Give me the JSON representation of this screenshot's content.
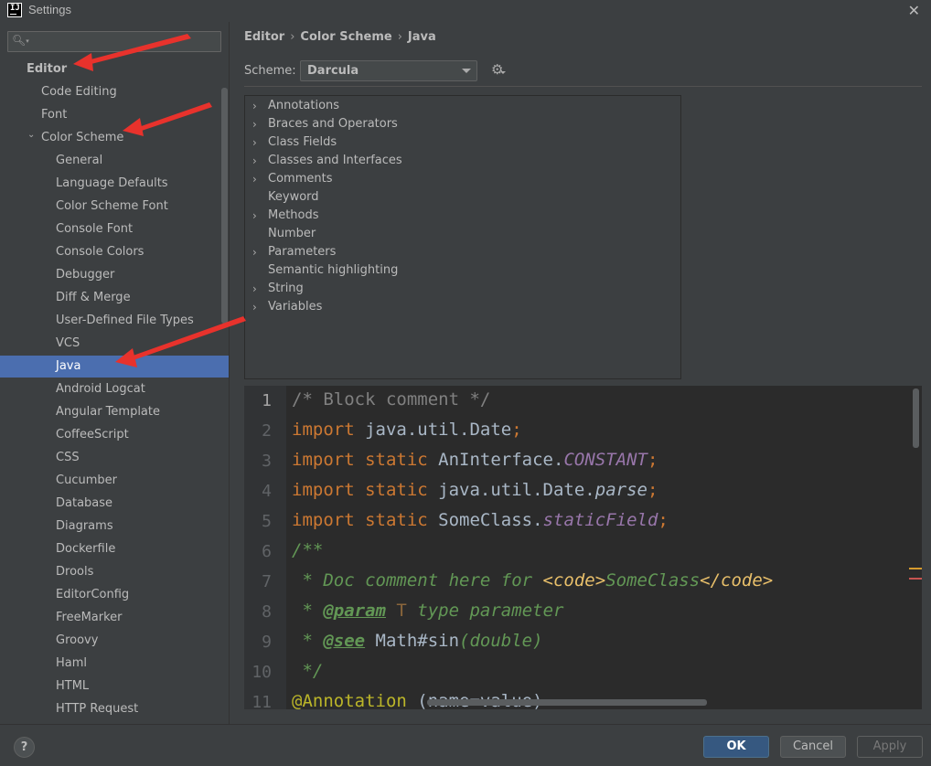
{
  "window": {
    "title": "Settings",
    "app_icon_text": "IJ"
  },
  "search": {
    "value": ""
  },
  "sidebar": {
    "items": [
      {
        "label": "Editor",
        "level": 0,
        "bold": true
      },
      {
        "label": "Code Editing",
        "level": 1
      },
      {
        "label": "Font",
        "level": 1
      },
      {
        "label": "Color Scheme",
        "level": 1,
        "expanded": true
      },
      {
        "label": "General",
        "level": 2
      },
      {
        "label": "Language Defaults",
        "level": 2
      },
      {
        "label": "Color Scheme Font",
        "level": 2
      },
      {
        "label": "Console Font",
        "level": 2
      },
      {
        "label": "Console Colors",
        "level": 2
      },
      {
        "label": "Debugger",
        "level": 2
      },
      {
        "label": "Diff & Merge",
        "level": 2
      },
      {
        "label": "User-Defined File Types",
        "level": 2
      },
      {
        "label": "VCS",
        "level": 2
      },
      {
        "label": "Java",
        "level": 2,
        "selected": true
      },
      {
        "label": "Android Logcat",
        "level": 2
      },
      {
        "label": "Angular Template",
        "level": 2
      },
      {
        "label": "CoffeeScript",
        "level": 2
      },
      {
        "label": "CSS",
        "level": 2
      },
      {
        "label": "Cucumber",
        "level": 2
      },
      {
        "label": "Database",
        "level": 2
      },
      {
        "label": "Diagrams",
        "level": 2
      },
      {
        "label": "Dockerfile",
        "level": 2
      },
      {
        "label": "Drools",
        "level": 2
      },
      {
        "label": "EditorConfig",
        "level": 2
      },
      {
        "label": "FreeMarker",
        "level": 2
      },
      {
        "label": "Groovy",
        "level": 2
      },
      {
        "label": "Haml",
        "level": 2
      },
      {
        "label": "HTML",
        "level": 2
      },
      {
        "label": "HTTP Request",
        "level": 2
      }
    ]
  },
  "breadcrumb": {
    "parts": [
      "Editor",
      "Color Scheme",
      "Java"
    ],
    "separator": "›"
  },
  "scheme": {
    "label": "Scheme:",
    "value": "Darcula"
  },
  "attributes": [
    {
      "label": "Annotations",
      "expandable": true
    },
    {
      "label": "Braces and Operators",
      "expandable": true
    },
    {
      "label": "Class Fields",
      "expandable": true
    },
    {
      "label": "Classes and Interfaces",
      "expandable": true
    },
    {
      "label": "Comments",
      "expandable": true
    },
    {
      "label": "Keyword",
      "expandable": false
    },
    {
      "label": "Methods",
      "expandable": true
    },
    {
      "label": "Number",
      "expandable": false
    },
    {
      "label": "Parameters",
      "expandable": true
    },
    {
      "label": "Semantic highlighting",
      "expandable": false
    },
    {
      "label": "String",
      "expandable": true
    },
    {
      "label": "Variables",
      "expandable": true
    }
  ],
  "code_preview": {
    "line_numbers": [
      "1",
      "2",
      "3",
      "4",
      "5",
      "6",
      "7",
      "8",
      "9",
      "10",
      "11"
    ],
    "lines": [
      [
        {
          "t": "/* Block comment */",
          "c": "cm"
        }
      ],
      [
        {
          "t": "import",
          "c": "kw"
        },
        {
          "t": " java.util.Date",
          "c": ""
        },
        {
          "t": ";",
          "c": "kw"
        }
      ],
      [
        {
          "t": "import static",
          "c": "kw"
        },
        {
          "t": " AnInterface.",
          "c": ""
        },
        {
          "t": "CONSTANT",
          "c": "pconst"
        },
        {
          "t": ";",
          "c": "kw"
        }
      ],
      [
        {
          "t": "import static",
          "c": "kw"
        },
        {
          "t": " java.util.Date.",
          "c": ""
        },
        {
          "t": "parse",
          "c": "itl"
        },
        {
          "t": ";",
          "c": "kw"
        }
      ],
      [
        {
          "t": "import static",
          "c": "kw"
        },
        {
          "t": " SomeClass.",
          "c": ""
        },
        {
          "t": "staticField",
          "c": "pconst"
        },
        {
          "t": ";",
          "c": "kw"
        }
      ],
      [
        {
          "t": "/**",
          "c": "doc"
        }
      ],
      [
        {
          "t": " * Doc comment here for ",
          "c": "doc"
        },
        {
          "t": "<code>",
          "c": "tagt"
        },
        {
          "t": "SomeClass",
          "c": "doc"
        },
        {
          "t": "</code>",
          "c": "tagt"
        }
      ],
      [
        {
          "t": " * ",
          "c": "doc"
        },
        {
          "t": "@param",
          "c": "doctag"
        },
        {
          "t": " T",
          "c": "docval"
        },
        {
          "t": " type parameter",
          "c": "doc"
        }
      ],
      [
        {
          "t": " * ",
          "c": "doc"
        },
        {
          "t": "@see",
          "c": "doctag"
        },
        {
          "t": " Math#sin",
          "c": ""
        },
        {
          "t": "(double)",
          "c": "doc"
        }
      ],
      [
        {
          "t": " */",
          "c": "doc"
        }
      ],
      [
        {
          "t": "@Annotation",
          "c": "ann"
        },
        {
          "t": " (name=value)",
          "c": ""
        }
      ]
    ]
  },
  "footer": {
    "help": "?",
    "ok": "OK",
    "cancel": "Cancel",
    "apply": "Apply"
  }
}
